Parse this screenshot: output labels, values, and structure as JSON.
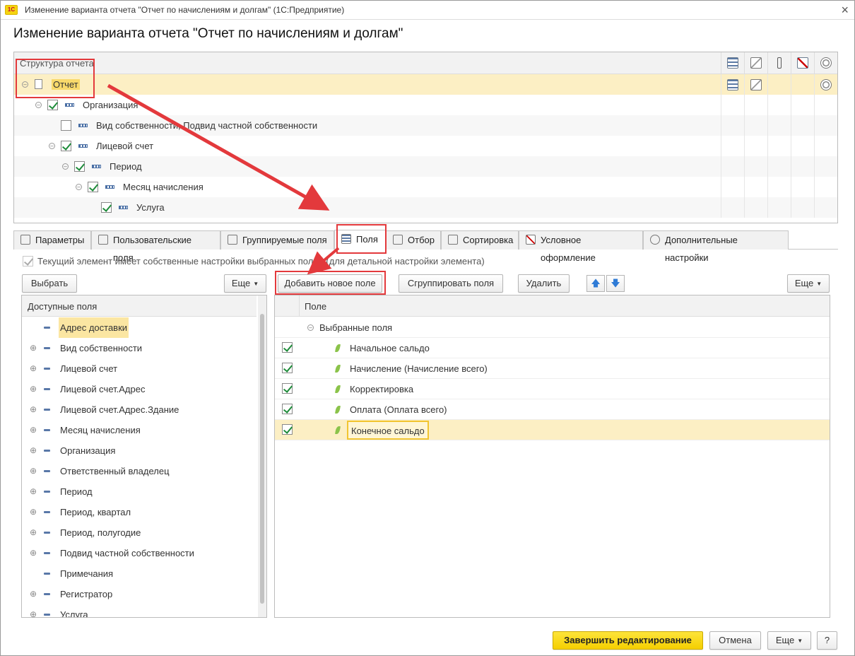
{
  "window": {
    "title": "Изменение варианта отчета \"Отчет по начислениям и долгам\"  (1С:Предприятие)",
    "logo_text": "1С",
    "close_label": "×"
  },
  "form_title": "Изменение варианта отчета \"Отчет по начислениям и долгам\"",
  "structure": {
    "header": "Структура отчета",
    "column_icons": [
      "groups-icon",
      "filter-icon",
      "order-icon",
      "conditional-format-icon",
      "settings-icon"
    ],
    "rows": [
      {
        "label": "Отчет",
        "level": 0,
        "checkbox": "none",
        "icon": "document-icon",
        "selected": true
      },
      {
        "label": "Организация",
        "level": 1,
        "checkbox": "checked",
        "icon": "grouping-icon"
      },
      {
        "label": "Вид собственности, Подвид частной собственности",
        "level": 2,
        "checkbox": "unchecked",
        "icon": "grouping-icon"
      },
      {
        "label": "Лицевой счет",
        "level": 2,
        "checkbox": "checked",
        "icon": "grouping-icon"
      },
      {
        "label": "Период",
        "level": 3,
        "checkbox": "checked",
        "icon": "grouping-icon"
      },
      {
        "label": "Месяц начисления",
        "level": 4,
        "checkbox": "checked",
        "icon": "grouping-icon"
      },
      {
        "label": "Услуга",
        "level": 5,
        "checkbox": "checked",
        "icon": "grouping-icon"
      }
    ]
  },
  "tabs": [
    {
      "label": "Параметры",
      "icon": "parameters-icon"
    },
    {
      "label": "Пользовательские поля",
      "icon": "user-fields-icon"
    },
    {
      "label": "Группируемые поля",
      "icon": "grouped-fields-icon"
    },
    {
      "label": "Поля",
      "icon": "fields-icon",
      "active": true
    },
    {
      "label": "Отбор",
      "icon": "filter-icon"
    },
    {
      "label": "Сортировка",
      "icon": "sort-icon"
    },
    {
      "label": "Условное оформление",
      "icon": "conditional-format-icon"
    },
    {
      "label": "Дополнительные настройки",
      "icon": "settings-icon"
    }
  ],
  "own_settings": {
    "checked": true,
    "label": "Текущий элемент имеет собственные настройки выбранных полей (для детальной настройки элемента)"
  },
  "left_toolbar": {
    "select_label": "Выбрать",
    "more_label": "Еще"
  },
  "right_toolbar": {
    "add_label": "Добавить новое поле",
    "group_label": "Сгруппировать поля",
    "delete_label": "Удалить",
    "up_label": "🡅",
    "down_label": "🡇",
    "more_label": "Еще"
  },
  "available_fields": {
    "header": "Доступные поля",
    "items": [
      {
        "label": "Адрес доставки",
        "expandable": false,
        "selected": true
      },
      {
        "label": "Вид собственности",
        "expandable": true
      },
      {
        "label": "Лицевой счет",
        "expandable": true
      },
      {
        "label": "Лицевой счет.Адрес",
        "expandable": true
      },
      {
        "label": "Лицевой счет.Адрес.Здание",
        "expandable": true
      },
      {
        "label": "Месяц начисления",
        "expandable": true
      },
      {
        "label": "Организация",
        "expandable": true
      },
      {
        "label": "Ответственный владелец",
        "expandable": true
      },
      {
        "label": "Период",
        "expandable": true
      },
      {
        "label": "Период, квартал",
        "expandable": true
      },
      {
        "label": "Период, полугодие",
        "expandable": true
      },
      {
        "label": "Подвид частной собственности",
        "expandable": true
      },
      {
        "label": "Примечания",
        "expandable": false
      },
      {
        "label": "Регистратор",
        "expandable": true
      },
      {
        "label": "Услуга",
        "expandable": true
      }
    ]
  },
  "selected_fields": {
    "header": "Поле",
    "group_label": "Выбранные поля",
    "items": [
      {
        "label": "Начальное сальдо",
        "checked": true
      },
      {
        "label": "Начисление (Начисление всего)",
        "checked": true
      },
      {
        "label": "Корректировка",
        "checked": true
      },
      {
        "label": "Оплата (Оплата всего)",
        "checked": true
      },
      {
        "label": "Конечное сальдо",
        "checked": true,
        "selected": true
      }
    ]
  },
  "footer": {
    "finish_label": "Завершить редактирование",
    "cancel_label": "Отмена",
    "more_label": "Еще",
    "help_label": "?"
  },
  "colors": {
    "selection": "#fcefc4",
    "accent_yellow": "#f5cf00",
    "annotation_red": "#e3393c",
    "check_green": "#1e8c3a"
  }
}
